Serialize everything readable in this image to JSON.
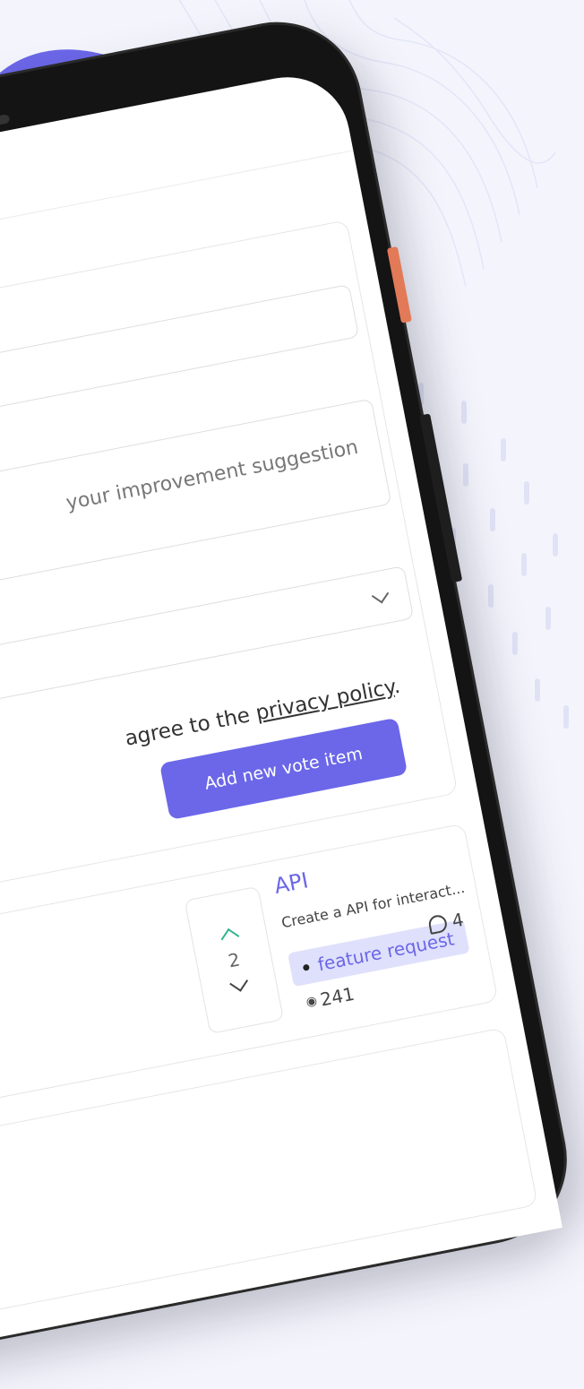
{
  "form": {
    "title_value": "",
    "description_placeholder": "your improvement suggestion",
    "category_value": "",
    "consent_prefix": "agree to the ",
    "privacy_link": "privacy policy",
    "consent_suffix": ".",
    "submit_label": "Add new vote item"
  },
  "vote_item": {
    "title": "API",
    "description": "Create a API for interact...",
    "votes": "2",
    "tag": "feature request",
    "views": "241",
    "comments": "4"
  },
  "colors": {
    "accent": "#6b67e8",
    "upvote": "#2fb58f",
    "badge_bg": "#dfe0fb",
    "button_orange": "#e27a57",
    "background": "#f4f5fc"
  }
}
